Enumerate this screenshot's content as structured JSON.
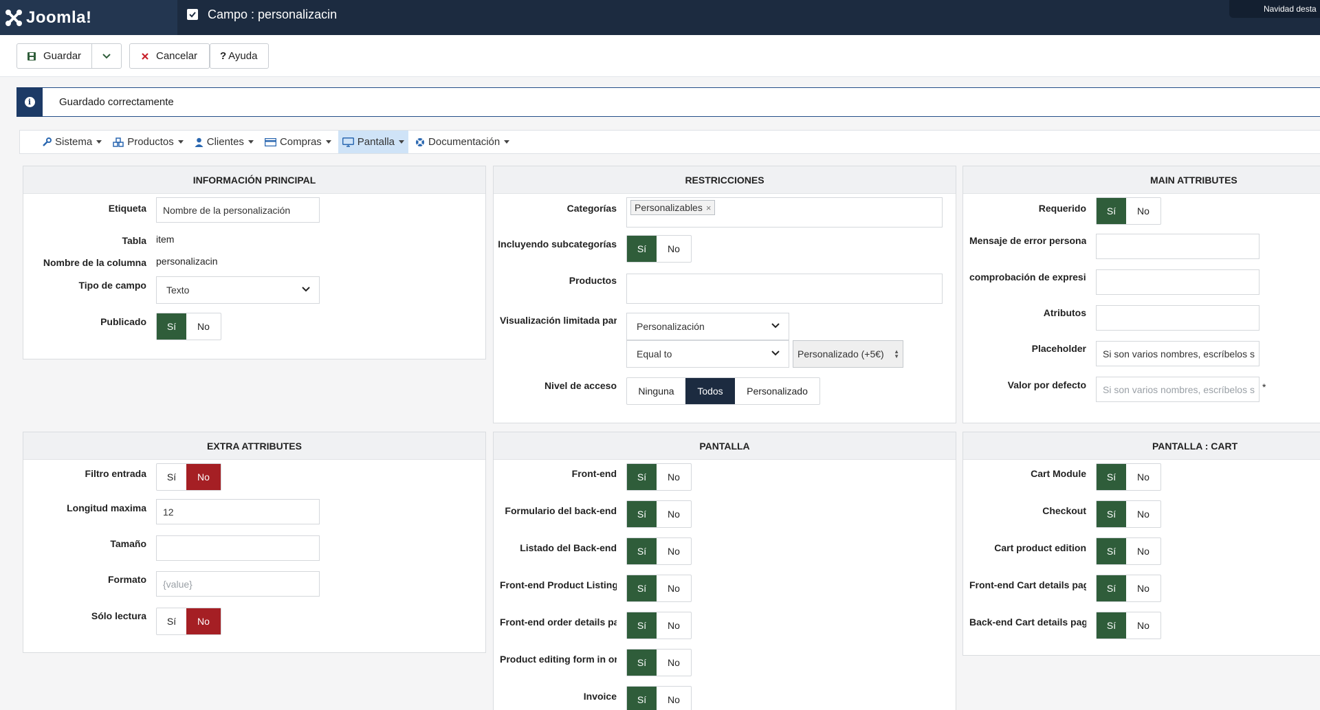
{
  "topbar": {
    "logo_text": "Joomla!",
    "page_title": "Campo : personalizacin",
    "nav_tab": "Navidad desta",
    "colors": {
      "bg": "#1c2b40",
      "success": "#2f5d3a",
      "danger": "#a51f24"
    }
  },
  "toolbar": {
    "save": "Guardar",
    "cancel": "Cancelar",
    "help": "Ayuda"
  },
  "alert": {
    "message": "Guardado correctamente"
  },
  "menu": [
    {
      "label": "Sistema",
      "icon": "wrench-icon"
    },
    {
      "label": "Productos",
      "icon": "cubes-icon"
    },
    {
      "label": "Clientes",
      "icon": "user-icon"
    },
    {
      "label": "Compras",
      "icon": "credit-card-icon"
    },
    {
      "label": "Pantalla",
      "icon": "monitor-icon",
      "active": true
    },
    {
      "label": "Documentación",
      "icon": "lifebuoy-icon"
    }
  ],
  "yes": "Sí",
  "no": "No",
  "info": {
    "title": "INFORMACIÓN PRINCIPAL",
    "etiqueta_label": "Etiqueta",
    "etiqueta_value": "Nombre de la personalización",
    "tabla_label": "Tabla",
    "tabla_value": "item",
    "columna_label": "Nombre de la columna",
    "columna_value": "personalizacin",
    "tipo_label": "Tipo de campo",
    "tipo_value": "Texto",
    "publicado_label": "Publicado"
  },
  "restricciones": {
    "title": "RESTRICCIONES",
    "categorias_label": "Categorías",
    "categorias_chip": "Personalizables",
    "subcat_label": "Incluyendo subcategorías",
    "productos_label": "Productos",
    "visual_label": "Visualización limitada par",
    "visual_field": "Personalización",
    "visual_op": "Equal to",
    "visual_value": "Personalizado (+5€)",
    "nivel_label": "Nivel de acceso",
    "nivel_options": [
      "Ninguna",
      "Todos",
      "Personalizado"
    ]
  },
  "main": {
    "title": "MAIN ATTRIBUTES",
    "requerido_label": "Requerido",
    "mensaje_label": "Mensaje de error persona",
    "regex_label": "comprobación de expresió",
    "atributos_label": "Atributos",
    "placeholder_label": "Placeholder",
    "placeholder_value": "Si son varios nombres, escríbelos s",
    "defecto_label": "Valor por defecto",
    "defecto_placeholder": "Si son varios nombres, escríbelos s",
    "required_mark": "*"
  },
  "extra": {
    "title": "EXTRA ATTRIBUTES",
    "filtro_label": "Filtro entrada",
    "longitud_label": "Longitud maxima",
    "longitud_value": "12",
    "tamano_label": "Tamaño",
    "formato_label": "Formato",
    "formato_placeholder": "{value}",
    "lectura_label": "Sólo lectura"
  },
  "pantalla": {
    "title": "PANTALLA",
    "rows": [
      "Front-end",
      "Formulario del back-end",
      "Listado del Back-end",
      "Front-end Product Listing",
      "Front-end order details pa",
      "Product editing form in or",
      "Invoice"
    ]
  },
  "cart": {
    "title": "PANTALLA : CART",
    "rows": [
      "Cart Module",
      "Checkout",
      "Cart product edition",
      "Front-end Cart details pag",
      "Back-end Cart details pag"
    ]
  }
}
